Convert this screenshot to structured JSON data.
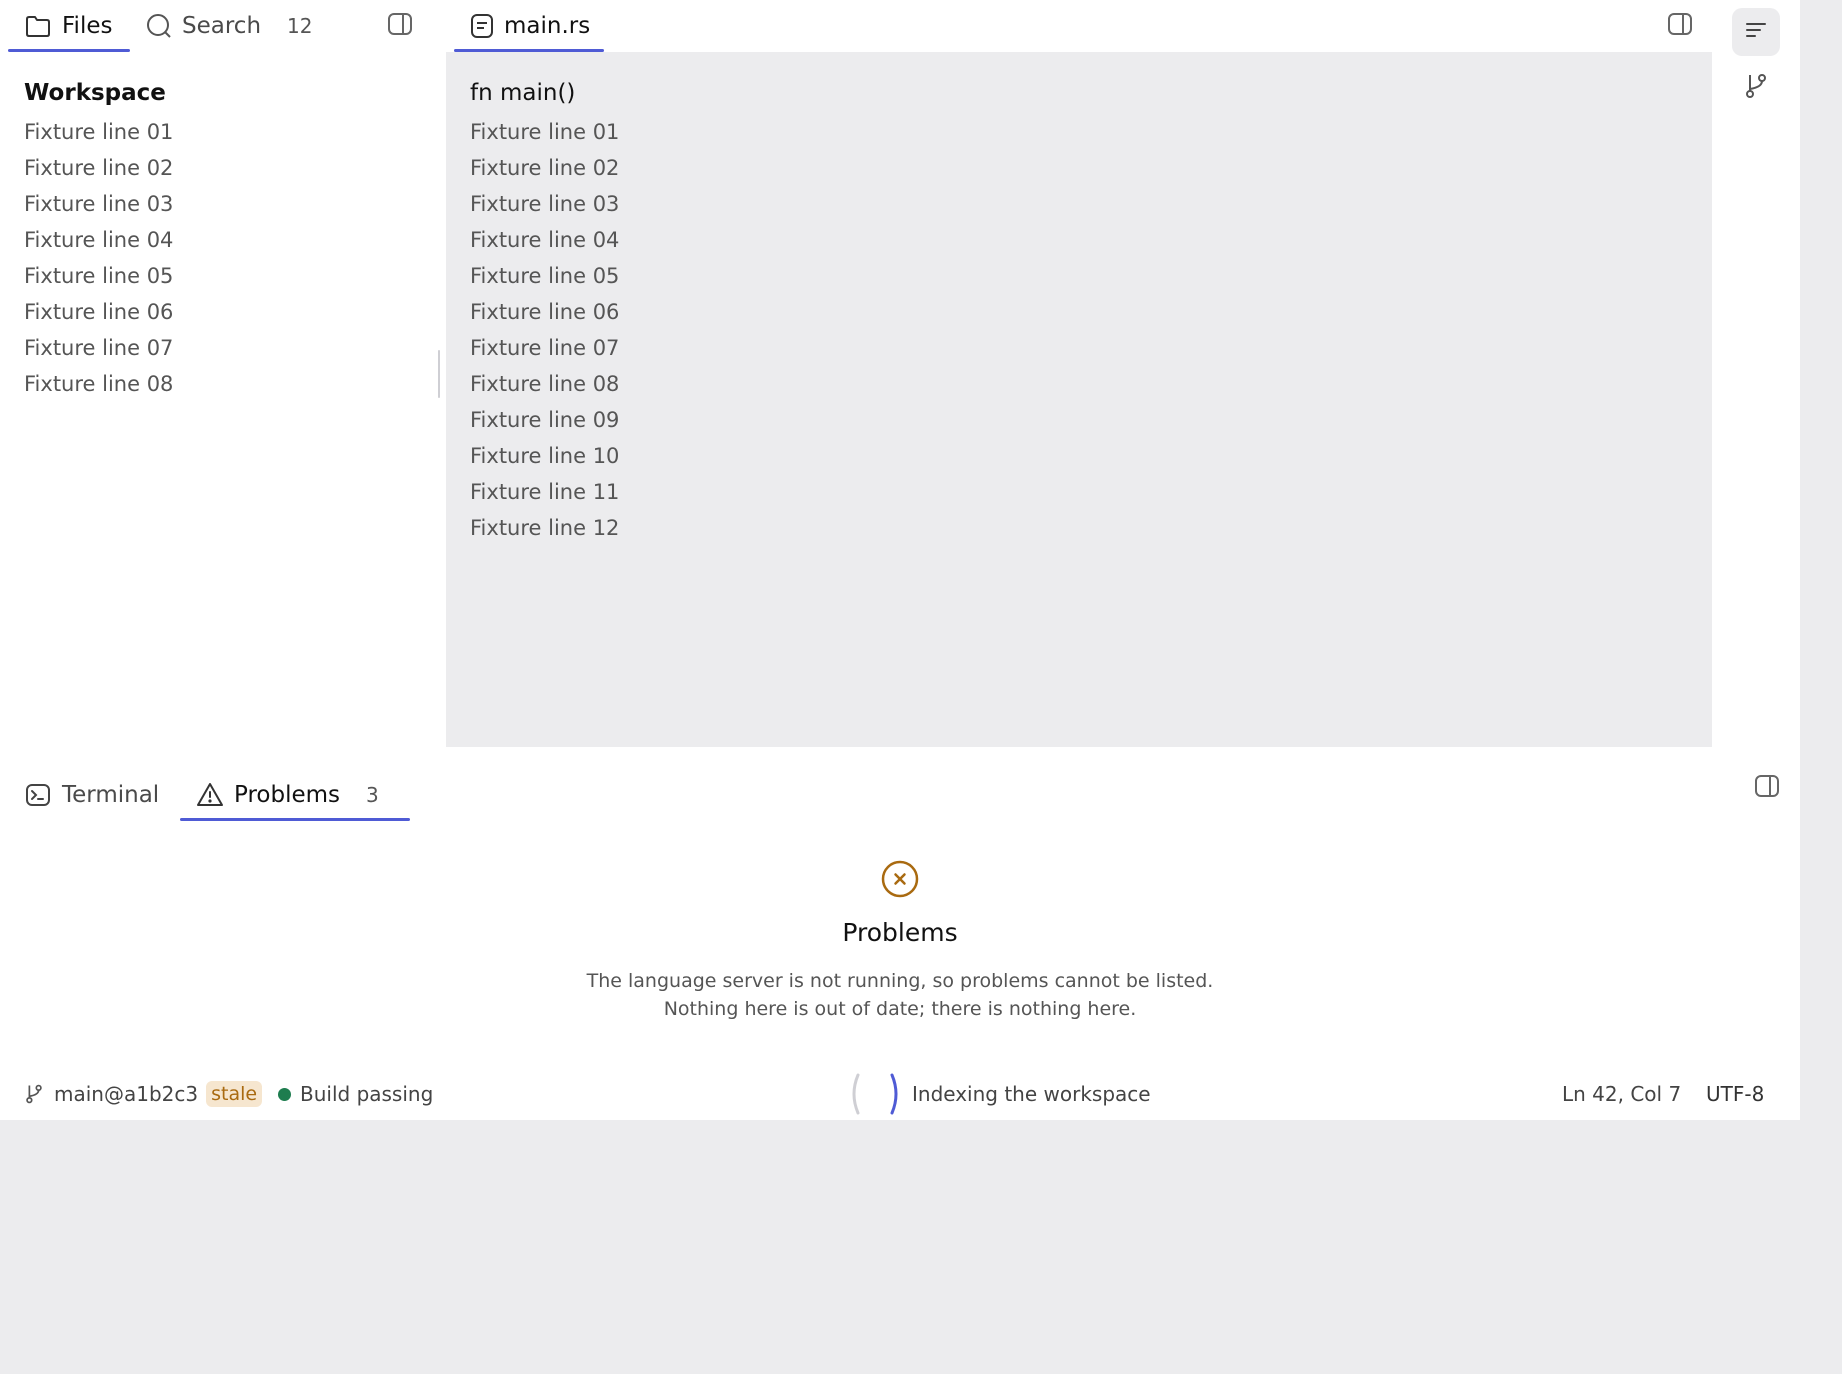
{
  "sidebar": {
    "tabs": [
      {
        "label": "Files",
        "icon": "folder-icon"
      },
      {
        "label": "Search",
        "icon": "search-icon",
        "count": "12"
      }
    ],
    "tree_title": "Workspace",
    "tree_items": [
      "Fixture line 01",
      "Fixture line 02",
      "Fixture line 03",
      "Fixture line 04",
      "Fixture line 05",
      "Fixture line 06",
      "Fixture line 07",
      "Fixture line 08"
    ]
  },
  "editor": {
    "tab_label": "main.rs",
    "function": "fn main()",
    "lines": [
      "Fixture line 01",
      "Fixture line 02",
      "Fixture line 03",
      "Fixture line 04",
      "Fixture line 05",
      "Fixture line 06",
      "Fixture line 07",
      "Fixture line 08",
      "Fixture line 09",
      "Fixture line 10",
      "Fixture line 11",
      "Fixture line 12"
    ]
  },
  "rail": {
    "buttons": [
      "outline-icon",
      "git-branch-icon"
    ]
  },
  "panel": {
    "tabs": [
      {
        "label": "Terminal",
        "icon": "terminal-icon"
      },
      {
        "label": "Problems",
        "icon": "warning-icon",
        "count": "3"
      }
    ],
    "empty_state": {
      "icon": "error-circle-icon",
      "title": "Problems",
      "line1": "The language server is not running, so problems cannot be listed.",
      "line2": "Nothing here is out of date; there is nothing here."
    }
  },
  "status": {
    "branch": "main@a1b2c3",
    "stale_badge": "stale",
    "build": "Build passing",
    "indexing": "Indexing the workspace",
    "cursor": "Ln 42, Col 7",
    "encoding": "UTF-8"
  },
  "colors": {
    "accent": "#4f5bd5",
    "success": "#1e7d4f",
    "warning": "#a96a10",
    "surface": "#ececee"
  }
}
